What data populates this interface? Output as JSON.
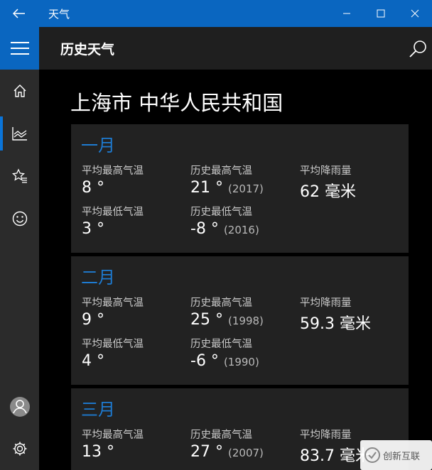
{
  "titlebar": {
    "title": "天气"
  },
  "header": {
    "title": "历史天气"
  },
  "location": "上海市 中华人民共和国",
  "labels": {
    "avg_high": "平均最高气温",
    "record_high": "历史最高气温",
    "avg_rain": "平均降雨量",
    "avg_low": "平均最低气温",
    "record_low": "历史最低气温"
  },
  "months": [
    {
      "name": "一月",
      "avg_high": "8 °",
      "record_high": "21 °",
      "record_high_year": "(2017)",
      "avg_rain": "62 毫米",
      "avg_low": "3 °",
      "record_low": "-8 °",
      "record_low_year": "(2016)"
    },
    {
      "name": "二月",
      "avg_high": "9 °",
      "record_high": "25 °",
      "record_high_year": "(1998)",
      "avg_rain": "59.3 毫米",
      "avg_low": "4 °",
      "record_low": "-6 °",
      "record_low_year": "(1990)"
    },
    {
      "name": "三月",
      "avg_high": "13 °",
      "record_high": "27 °",
      "record_high_year": "(2007)",
      "avg_rain": "83.7 毫米"
    }
  ],
  "watermark": {
    "text": "创新互联"
  },
  "colors": {
    "accent": "#0a66c0",
    "month_title": "#1e7bd1",
    "card": "#222222",
    "sidebar": "#2b2b2b"
  },
  "icons": {
    "back": "back-arrow-icon",
    "minimize": "minimize-icon",
    "maximize": "maximize-icon",
    "close": "close-icon",
    "menu": "hamburger-menu-icon",
    "home": "home-icon",
    "history": "historical-chart-icon",
    "favorites": "favorites-star-icon",
    "emoji": "smiley-icon",
    "account": "account-icon",
    "settings": "settings-gear-icon",
    "search": "search-icon"
  }
}
